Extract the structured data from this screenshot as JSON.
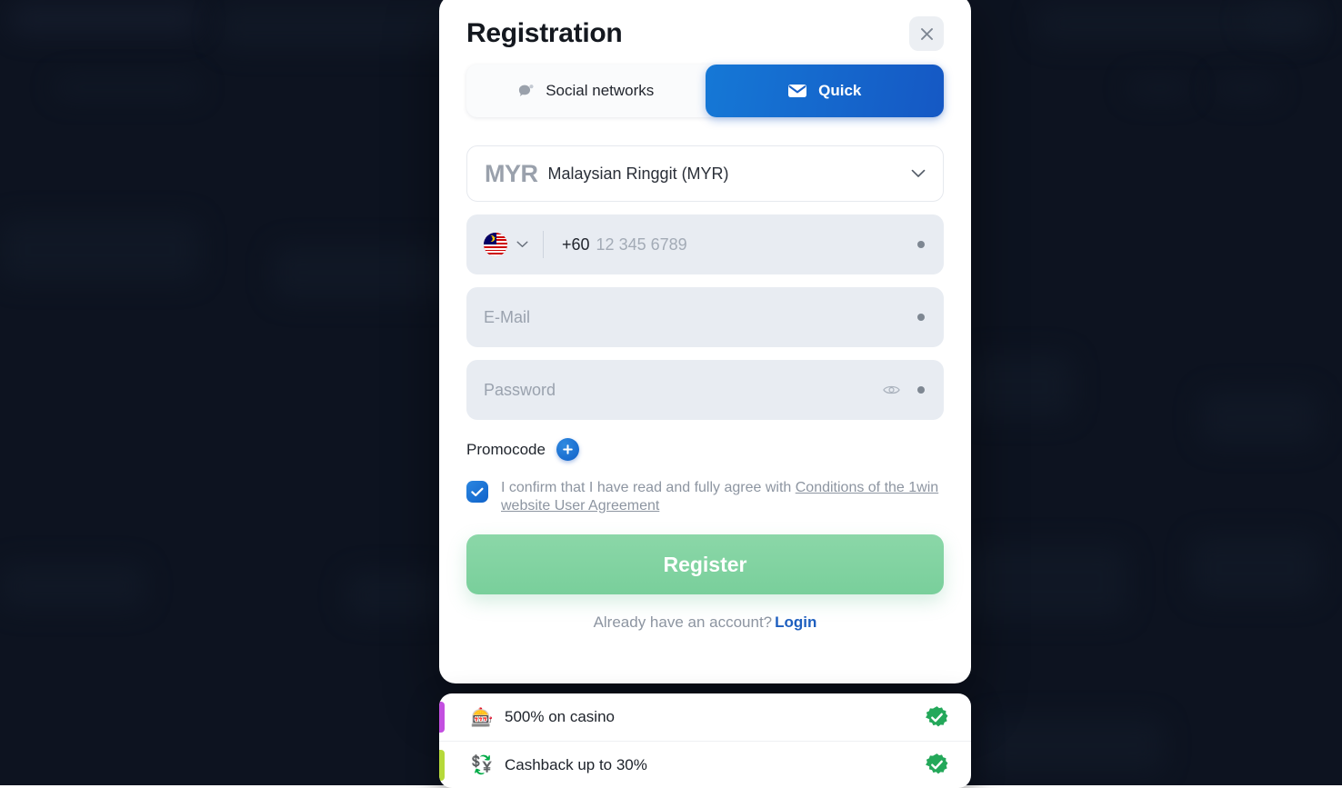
{
  "backdrop": {
    "color": "#0d1320"
  },
  "modal": {
    "title": "Registration",
    "close_icon": "close-icon",
    "tabs": [
      {
        "label": "Social networks",
        "icon": "chat-bubble-icon",
        "active": false
      },
      {
        "label": "Quick",
        "icon": "envelope-icon",
        "active": true
      }
    ],
    "currency": {
      "code": "MYR",
      "name": "Malaysian Ringgit (MYR)",
      "chevron_icon": "chevron-down-icon"
    },
    "phone": {
      "flag": "malaysia-flag-icon",
      "chevron_icon": "chevron-down-icon",
      "dial_code": "+60",
      "placeholder": "12 345 6789"
    },
    "email": {
      "placeholder": "E-Mail"
    },
    "password": {
      "placeholder": "Password",
      "eye_icon": "eye-icon"
    },
    "promocode": {
      "label": "Promocode",
      "add_icon": "plus-icon"
    },
    "agreement": {
      "text": "I confirm that I have read and fully agree with ",
      "link": "Conditions of the 1win website User Agreement",
      "checked": true
    },
    "register_label": "Register",
    "login_prompt": "Already have an account?",
    "login_label": "Login"
  },
  "bonuses": [
    {
      "emoji": "🎰",
      "label": "500% on casino",
      "accent": "#c34fe0",
      "badge_icon": "verified-badge-icon"
    },
    {
      "emoji": "💱",
      "label": "Cashback up to 30%",
      "accent": "#b6d93a",
      "badge_icon": "verified-badge-icon"
    }
  ],
  "colors": {
    "brand_blue": "#1578d6",
    "brand_blue_dark": "#1558c4",
    "register_green": "#79cf9b",
    "verified_green": "#24a85a",
    "field_bg": "#e8ecf2"
  }
}
